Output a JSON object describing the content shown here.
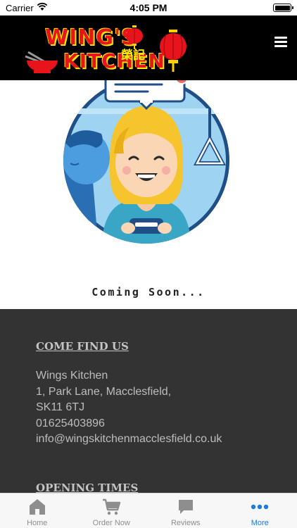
{
  "status_bar": {
    "carrier": "Carrier",
    "time": "4:05 PM"
  },
  "header": {
    "logo_line1": "WING'S",
    "logo_line2": "KITCHEN",
    "logo_chinese": "榮記",
    "menu_icon": "hamburger-icon"
  },
  "main": {
    "coming_soon": "Coming Soon..."
  },
  "footer": {
    "find_us_title": "COME FIND US",
    "address_lines": [
      "Wings Kitchen",
      "1, Park Lane, Macclesfield,",
      "SK11 6TJ",
      "01625403896",
      "info@wingskitchenmacclesfield.co.uk"
    ],
    "opening_times_title": "OPENING TIMES"
  },
  "tab_bar": {
    "tabs": [
      {
        "label": "Home",
        "icon": "home-icon"
      },
      {
        "label": "Order Now",
        "icon": "cart-icon"
      },
      {
        "label": "Reviews",
        "icon": "chat-icon"
      },
      {
        "label": "More",
        "icon": "more-icon"
      }
    ],
    "active_index": 3
  },
  "colors": {
    "accent": "#1e7be0",
    "footer_bg": "#333333",
    "header_bg": "#000000",
    "logo_red": "#e8141c"
  }
}
